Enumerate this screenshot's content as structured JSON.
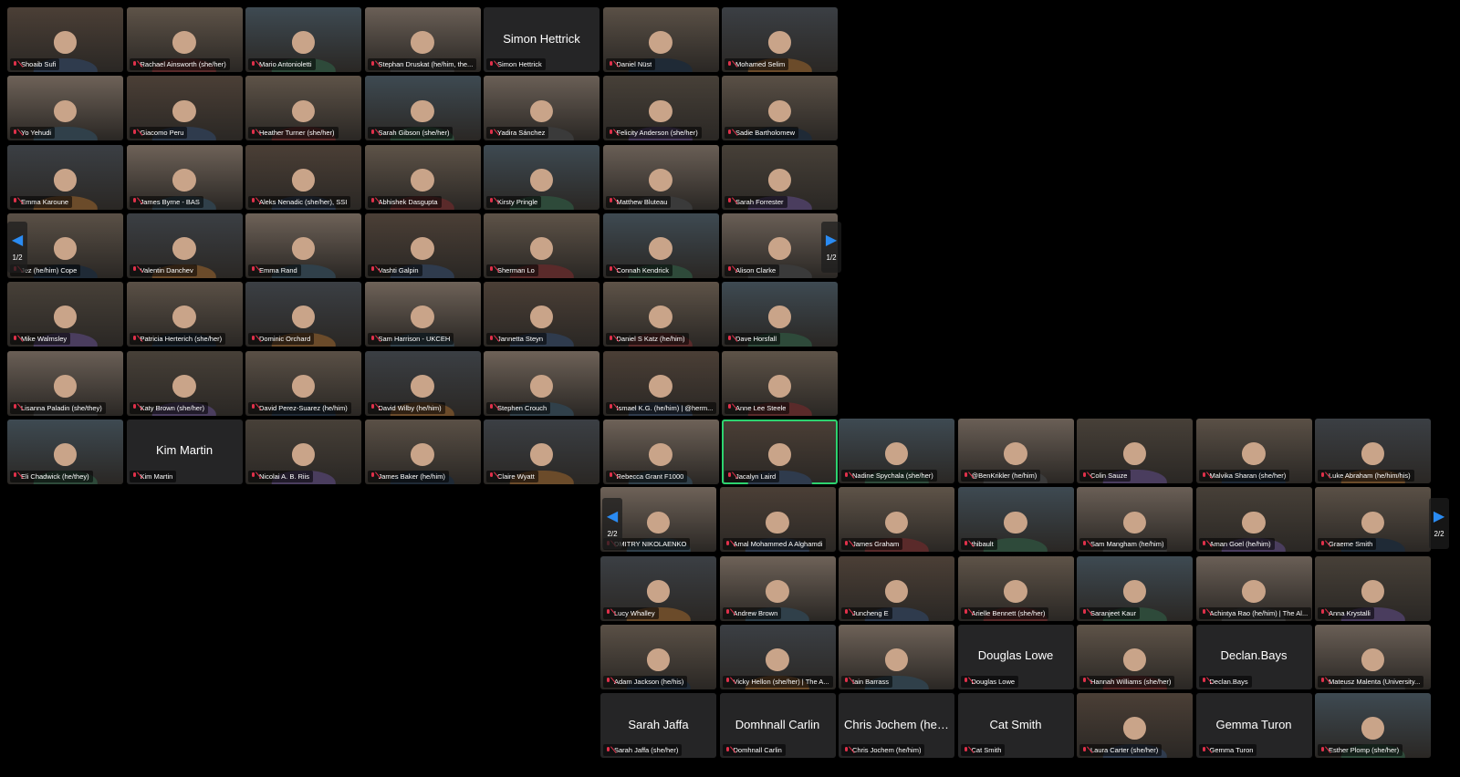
{
  "gallery1": {
    "tiles": [
      {
        "name": "Shoaib Sufi",
        "video": true
      },
      {
        "name": "Rachael Ainsworth (she/her)",
        "video": true
      },
      {
        "name": "Mario Antonioletti",
        "video": true
      },
      {
        "name": "Stephan Druskat (he/him, the...",
        "video": true
      },
      {
        "name": "Simon Hettrick",
        "video": false,
        "display": "Simon Hettrick"
      },
      {
        "name": "Daniel Nüst",
        "video": true
      },
      {
        "name": "Mohamed Selim",
        "video": true
      },
      {
        "name": "Yo Yehudi",
        "video": true
      },
      {
        "name": "Giacomo Peru",
        "video": true
      },
      {
        "name": "Heather Turner (she/her)",
        "video": true
      },
      {
        "name": "Sarah Gibson (she/her)",
        "video": true
      },
      {
        "name": "Yadira Sánchez",
        "video": true
      },
      {
        "name": "Felicity Anderson (she/her)",
        "video": true
      },
      {
        "name": "Sadie Bartholomew",
        "video": true
      },
      {
        "name": "Emma Karoune",
        "video": true
      },
      {
        "name": "James Byrne - BAS",
        "video": true
      },
      {
        "name": "Aleks Nenadic (she/her), SSI",
        "video": true
      },
      {
        "name": "Abhishek Dasgupta",
        "video": true
      },
      {
        "name": "Kirsty Pringle",
        "video": true
      },
      {
        "name": "Matthew Bluteau",
        "video": true
      },
      {
        "name": "Sarah Forrester",
        "video": true
      },
      {
        "name": "Jez (he/him) Cope",
        "video": true
      },
      {
        "name": "Valentin Danchev",
        "video": true
      },
      {
        "name": "Emma Rand",
        "video": true
      },
      {
        "name": "Vashti Galpin",
        "video": true
      },
      {
        "name": "Sherman Lo",
        "video": true
      },
      {
        "name": "Connah Kendrick",
        "video": true
      },
      {
        "name": "Alison Clarke",
        "video": true
      },
      {
        "name": "Mike Walmsley",
        "video": true
      },
      {
        "name": "Patricia Herterich (she/her)",
        "video": true
      },
      {
        "name": "Dominic Orchard",
        "video": true
      },
      {
        "name": "Sam Harrison - UKCEH",
        "video": true
      },
      {
        "name": "Jannetta Steyn",
        "video": true
      },
      {
        "name": "Daniel S Katz (he/him)",
        "video": true
      },
      {
        "name": "Dave Horsfall",
        "video": true
      },
      {
        "name": "Lisanna Paladin (she/they)",
        "video": true
      },
      {
        "name": "Katy Brown (she/her)",
        "video": true
      },
      {
        "name": "David Perez-Suarez (he/him)",
        "video": true
      },
      {
        "name": "David Wilby (he/him)",
        "video": true
      },
      {
        "name": "Stephen Crouch",
        "video": true
      },
      {
        "name": "Ismael K.G. (he/him) | @herm...",
        "video": true
      },
      {
        "name": "Anne Lee Steele",
        "video": true
      },
      {
        "name": "Eli Chadwick (he/they)",
        "video": true
      },
      {
        "name": "Kim Martin",
        "video": false,
        "display": "Kim Martin"
      },
      {
        "name": "Nicolai A. B. Riis",
        "video": true
      },
      {
        "name": "James Baker (he/him)",
        "video": true
      },
      {
        "name": "Claire Wyatt",
        "video": true
      },
      {
        "name": "Rebecca Grant F1000",
        "video": true
      },
      {
        "name": "Jacalyn Laird",
        "video": true,
        "active": true
      }
    ],
    "page_indicator_left": "1/2",
    "page_indicator_right": "1/2"
  },
  "gallery2": {
    "tiles": [
      {
        "name": "Nadine Spychala (she/her)",
        "video": true
      },
      {
        "name": "@BenKrikler (he/him)",
        "video": true
      },
      {
        "name": "Colin Sauze",
        "video": true
      },
      {
        "name": "Malvika Sharan  (she/her)",
        "video": true
      },
      {
        "name": "Luke Abraham (he/him/his)",
        "video": true
      },
      {
        "name": "DMITRY NIKOLAENKO",
        "video": true
      },
      {
        "name": "Amal Mohammed A Alghamdi",
        "video": true
      },
      {
        "name": "James Graham",
        "video": true
      },
      {
        "name": "thibault",
        "video": true
      },
      {
        "name": "Sam Mangham (he/him)",
        "video": true
      },
      {
        "name": "Aman Goel (he/him)",
        "video": true
      },
      {
        "name": "Graeme Smith",
        "video": true
      },
      {
        "name": "Lucy Whalley",
        "video": true
      },
      {
        "name": "Andrew Brown",
        "video": true
      },
      {
        "name": "Juncheng E",
        "video": true
      },
      {
        "name": "Arielle Bennett (she/her)",
        "video": true
      },
      {
        "name": "Saranjeet Kaur",
        "video": true
      },
      {
        "name": "Achintya Rao (he/him) | The Al...",
        "video": true
      },
      {
        "name": "Anna Krystalli",
        "video": true
      },
      {
        "name": "Adam Jackson (he/his)",
        "video": true
      },
      {
        "name": "Vicky Hellon (she/her) | The A...",
        "video": true
      },
      {
        "name": "Iain Barrass",
        "video": true
      },
      {
        "name": "Douglas Lowe",
        "video": false,
        "display": "Douglas Lowe"
      },
      {
        "name": "Hannah Williams (she/her)",
        "video": true
      },
      {
        "name": "Declan.Bays",
        "video": false,
        "display": "Declan.Bays"
      },
      {
        "name": "Mateusz Malenta (University...",
        "video": true
      },
      {
        "name": "Sarah Jaffa (she/her)",
        "video": false,
        "display": "Sarah Jaffa"
      },
      {
        "name": "Domhnall Carlin",
        "video": false,
        "display": "Domhnall Carlin"
      },
      {
        "name": "Chris Jochem (he/him)",
        "video": false,
        "display": "Chris Jochem (he/..."
      },
      {
        "name": "Cat Smith",
        "video": false,
        "display": "Cat Smith"
      },
      {
        "name": "Laura Carter (she/her)",
        "video": true
      },
      {
        "name": "Gemma Turon",
        "video": false,
        "display": "Gemma Turon"
      },
      {
        "name": "Esther Plomp (she/her)",
        "video": true
      }
    ],
    "page_indicator_left": "2/2",
    "page_indicator_right": "2/2"
  },
  "colors": {
    "background": "#000000",
    "tile": "#252526",
    "active_border": "#2dd36f",
    "nav_arrow": "#2a8bf2",
    "muted_mic": "#e0304a"
  },
  "icons": {
    "mic": "mic-muted-icon",
    "prev": "chevron-left-icon",
    "next": "chevron-right-icon"
  }
}
